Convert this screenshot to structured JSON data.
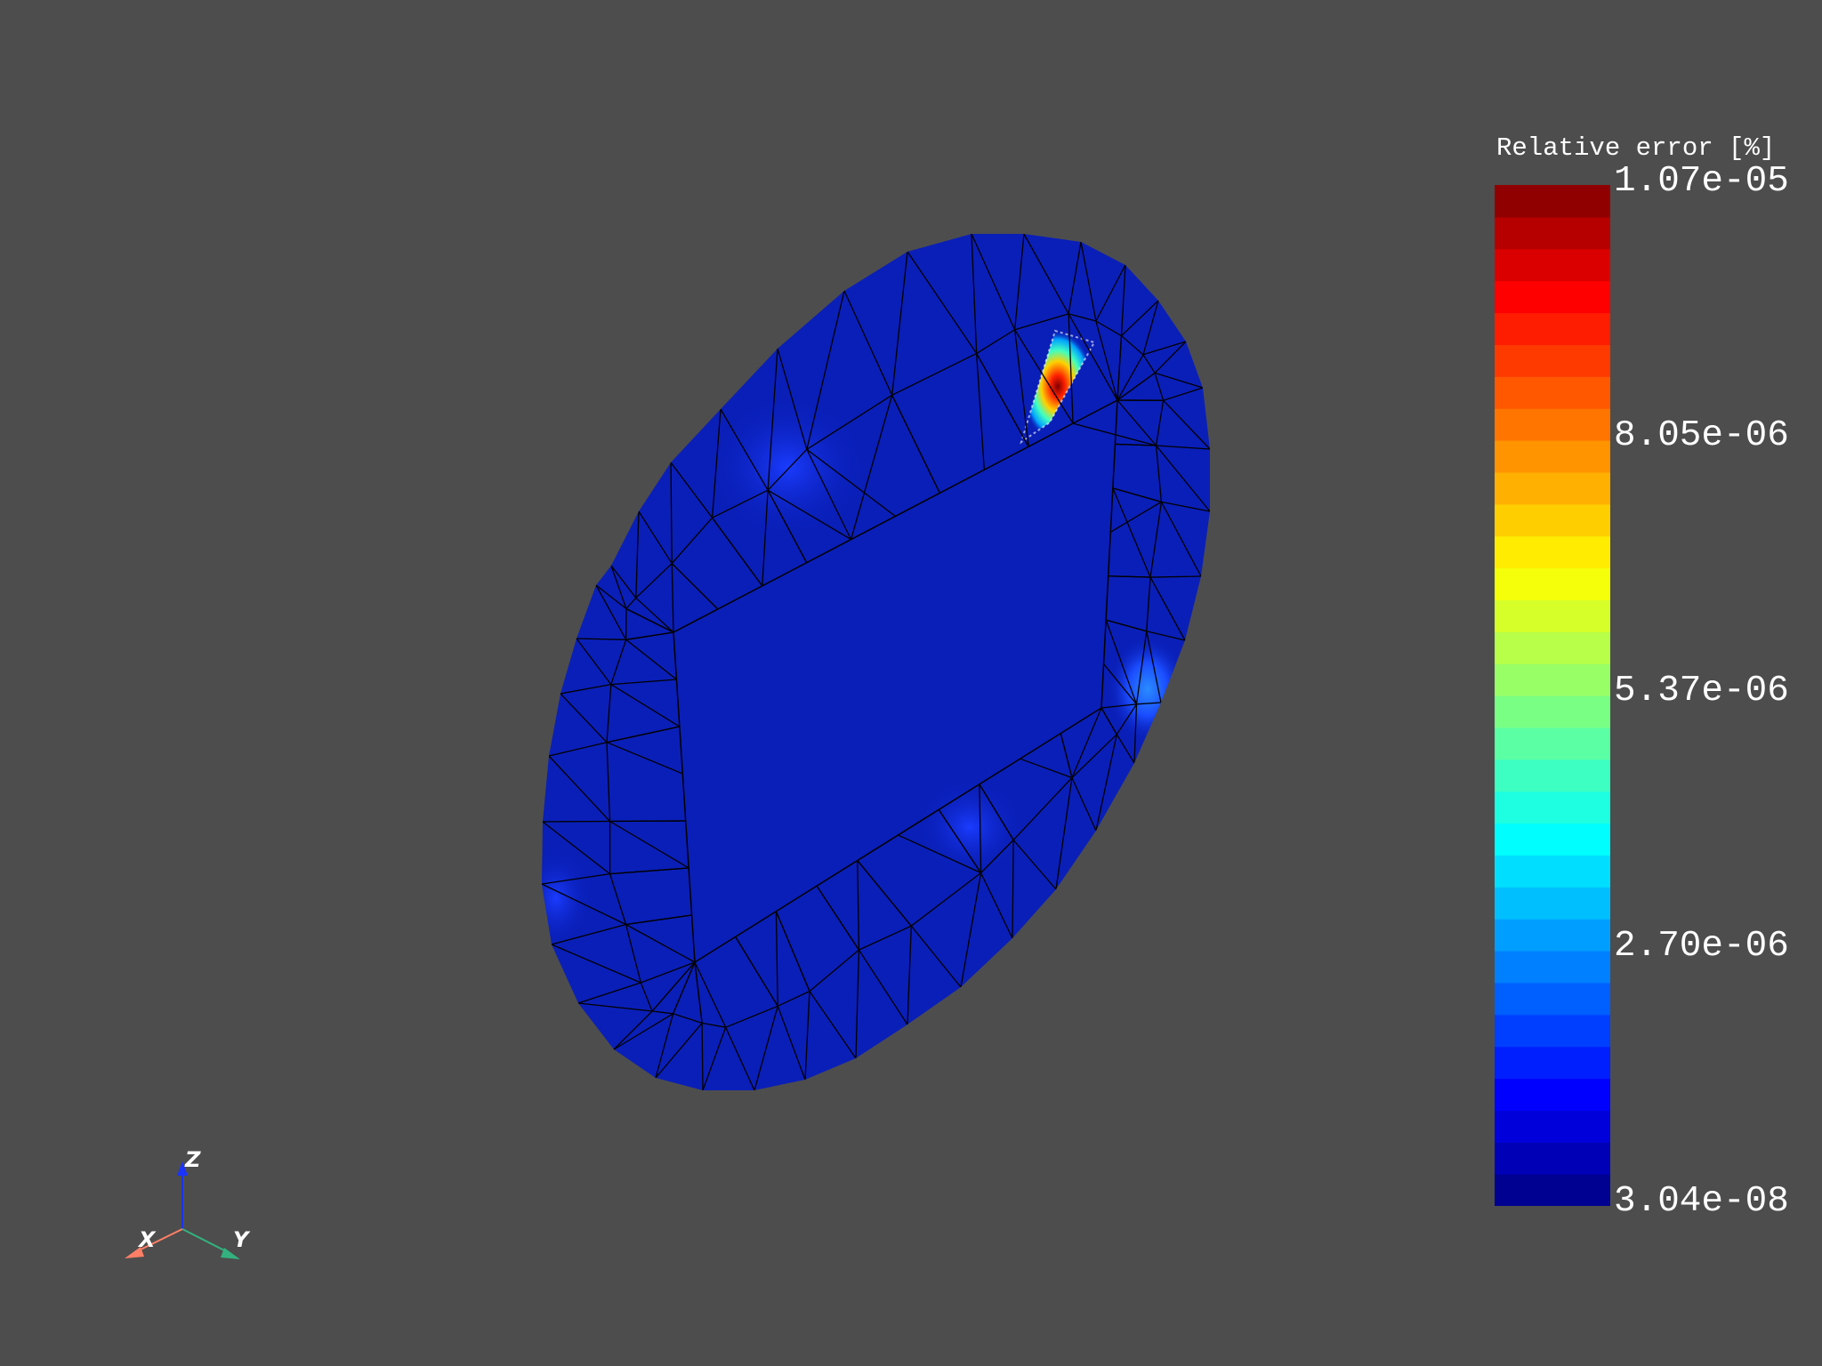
{
  "scalar_bar": {
    "title": "Relative error [%]",
    "max_label": "1.07e-05",
    "labels": [
      "1.07e-05",
      "8.05e-06",
      "5.37e-06",
      "2.70e-06",
      "3.04e-08"
    ],
    "min_label": "3.04e-08",
    "colormap": "jet",
    "colormap_stops": [
      "#00007f",
      "#0000ff",
      "#00ffff",
      "#ffff00",
      "#ff0000",
      "#7f0000"
    ],
    "n_colors": 32
  },
  "orientation_widget": {
    "axes": [
      {
        "label": "X",
        "color": "#ff7f66"
      },
      {
        "label": "Y",
        "color": "#33b27f"
      },
      {
        "label": "Z",
        "color": "#1a33ff"
      }
    ]
  },
  "render": {
    "background": "#4d4d4d",
    "mesh_edge_color": "#000000",
    "base_field_color": "#0a1fb8"
  }
}
